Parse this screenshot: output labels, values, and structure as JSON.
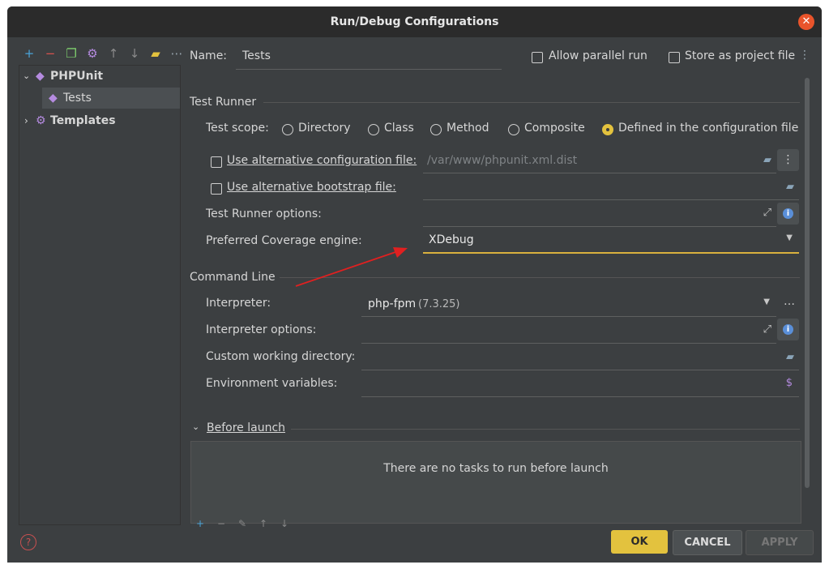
{
  "window": {
    "title": "Run/Debug Configurations"
  },
  "toolbar": {
    "icons": [
      "add-icon",
      "remove-icon",
      "copy-icon",
      "settings-icon",
      "move-up-icon",
      "move-down-icon",
      "folder-icon",
      "more-icon"
    ]
  },
  "tree": {
    "items": [
      {
        "label": "PHPUnit"
      },
      {
        "label": "Tests"
      },
      {
        "label": "Templates"
      }
    ]
  },
  "header": {
    "name_label": "Name:",
    "name_value": "Tests",
    "parallel_label": "Allow parallel run",
    "store_label": "Store as project file"
  },
  "test_runner": {
    "section_title": "Test Runner",
    "scope_label": "Test scope:",
    "scopes": [
      "Directory",
      "Class",
      "Method",
      "Composite",
      "Defined in the configuration file"
    ],
    "alt_config_label": "Use alternative configuration file:",
    "alt_config_value": "/var/www/phpunit.xml.dist",
    "alt_bootstrap_label": "Use alternative bootstrap file:",
    "runner_options_label": "Test Runner options:",
    "coverage_label": "Preferred Coverage engine:",
    "coverage_value": "XDebug"
  },
  "command_line": {
    "section_title": "Command Line",
    "interpreter_label": "Interpreter:",
    "interpreter_value": "php-fpm",
    "interpreter_version": "(7.3.25)",
    "interpreter_options_label": "Interpreter options:",
    "working_dir_label": "Custom working directory:",
    "env_label": "Environment variables:"
  },
  "before_launch": {
    "title": "Before launch",
    "empty_text": "There are no tasks to run before launch"
  },
  "footer": {
    "ok": "OK",
    "cancel": "CANCEL",
    "apply": "APPLY"
  },
  "colors": {
    "accent": "#e3c23e",
    "background": "#3c3f41",
    "annotation_arrow": "#e02020"
  }
}
